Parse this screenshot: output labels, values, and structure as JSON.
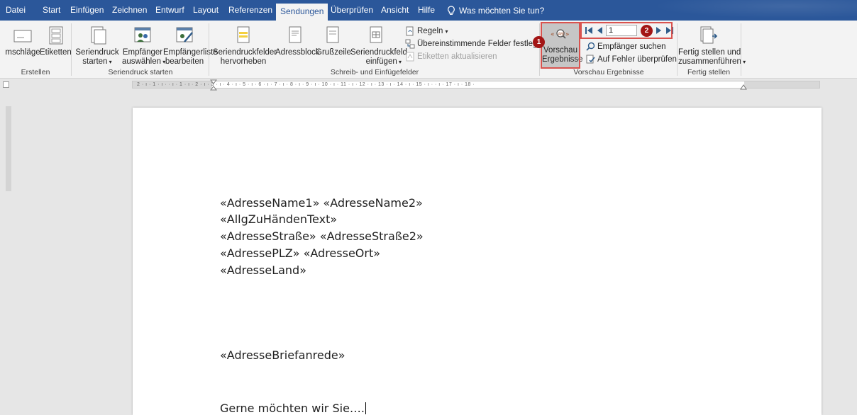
{
  "menu": {
    "tabs": [
      {
        "label": "Datei"
      },
      {
        "label": "Start"
      },
      {
        "label": "Einfügen"
      },
      {
        "label": "Zeichnen"
      },
      {
        "label": "Entwurf"
      },
      {
        "label": "Layout"
      },
      {
        "label": "Referenzen"
      },
      {
        "label": "Sendungen"
      },
      {
        "label": "Überprüfen"
      },
      {
        "label": "Ansicht"
      },
      {
        "label": "Hilfe"
      }
    ],
    "tell_me": "Was möchten Sie tun?",
    "active_tab": "Sendungen",
    "accent": "#2b579a"
  },
  "ribbon": {
    "erstellen": {
      "umschlaege": "mschläge",
      "etiketten": "Etiketten",
      "group": "Erstellen"
    },
    "seriendruck": {
      "starten_l1": "Seriendruck",
      "starten_l2": "starten",
      "empfaenger_l1": "Empfänger",
      "empfaenger_l2": "auswählen",
      "liste_l1": "Empfängerliste",
      "liste_l2": "bearbeiten",
      "group": "Seriendruck starten"
    },
    "felder": {
      "hervorheben_l1": "Seriendruckfelder",
      "hervorheben_l2": "hervorheben",
      "adressblock": "Adressblock",
      "grusszeile": "Grußzeile",
      "einfuegen_l1": "Seriendruckfeld",
      "einfuegen_l2": "einfügen",
      "regeln": "Regeln",
      "uebereinstimmende": "Übereinstimmende Felder festlegen",
      "aktualisieren": "Etiketten aktualisieren",
      "group": "Schreib- und Einfügefelder"
    },
    "vorschau": {
      "btn_l1": "Vorschau",
      "btn_l2": "Ergebnisse",
      "record": "1",
      "suchen": "Empfänger suchen",
      "fehler": "Auf Fehler überprüfen",
      "group": "Vorschau Ergebnisse",
      "badge1": "1",
      "badge2": "2"
    },
    "fertig": {
      "btn_l1": "Fertig stellen und",
      "btn_l2": "zusammenführen",
      "group": "Fertig stellen"
    }
  },
  "ruler": {
    "text": "2 · ı · 1 · ı ·     · ı · 1 · ı · 2 · ı · 3 · ı · 4 · ı · 5 · ı · 6 · ı · 7 · ı · 8 · ı · 9 · ı · 10 · ı · 11 · ı · 12 · ı · 13 · ı · 14 · ı · 15 · ı ·       · ı · 17 · ı · 18 ·"
  },
  "document": {
    "lines": [
      "«AdresseName1» «AdresseName2»",
      "«AllgZuHändenText»",
      "«AdresseStraße» «AdresseStraße2»",
      "«AdressePLZ» «AdresseOrt»",
      "«AdresseLand»"
    ],
    "anrede": "«AdresseBriefanrede»",
    "body": "Gerne möchten wir Sie…."
  }
}
